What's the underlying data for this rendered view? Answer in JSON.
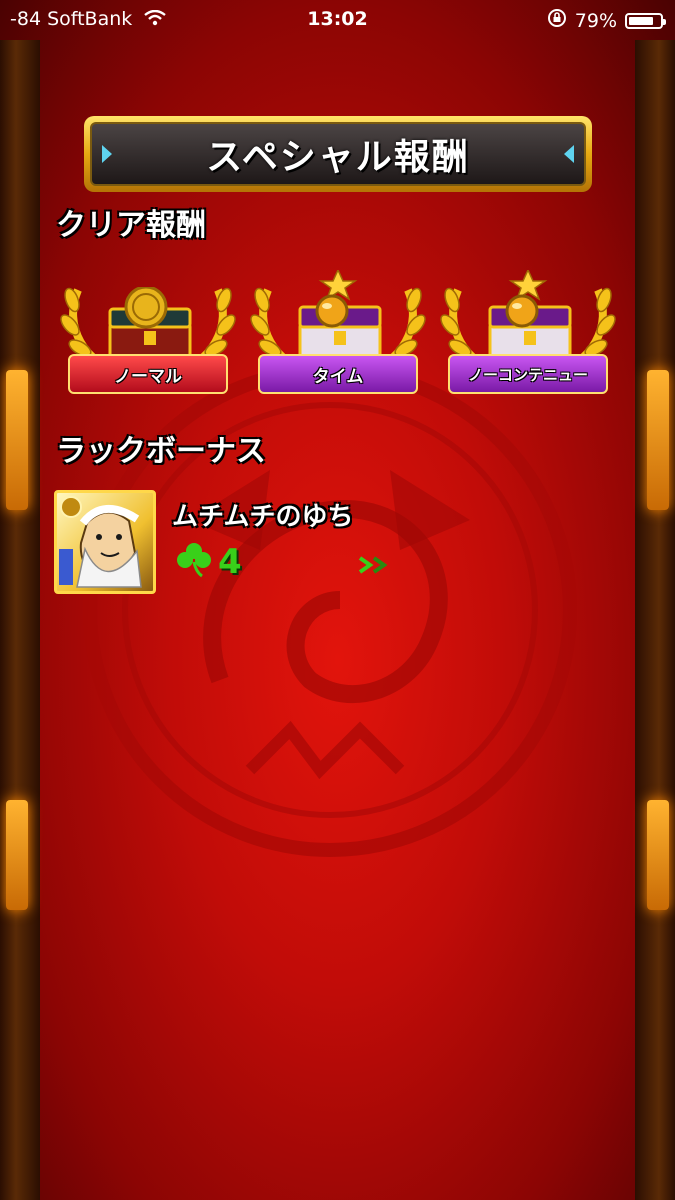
{
  "status_bar": {
    "carrier": "-84 SoftBank",
    "time": "13:02",
    "battery_percent": "79%",
    "battery_level": 0.79,
    "icons": [
      "wifi-icon",
      "rotation-lock-icon",
      "battery-icon"
    ]
  },
  "title": "スペシャル報酬",
  "clear_rewards": {
    "heading": "クリア報酬",
    "items": [
      {
        "label": "ノーマル",
        "color": "red",
        "icon": "gold-coin-chest-icon"
      },
      {
        "label": "タイム",
        "color": "purple",
        "icon": "orb-chest-icon"
      },
      {
        "label": "ノーコンテニュー",
        "color": "purple",
        "icon": "orb-chest-icon"
      }
    ]
  },
  "luck_bonus": {
    "heading": "ラックボーナス",
    "character_name": "ムチムチのゆち",
    "luck_value": "4",
    "icons": [
      "character-portrait-icon",
      "clover-icon",
      "double-arrow-icon"
    ]
  },
  "colors": {
    "background": "#c10c08",
    "gold": "#e6a912",
    "ribbon_red": "#d0202c",
    "ribbon_purple": "#a03ad0",
    "clover_green": "#39d01a"
  }
}
